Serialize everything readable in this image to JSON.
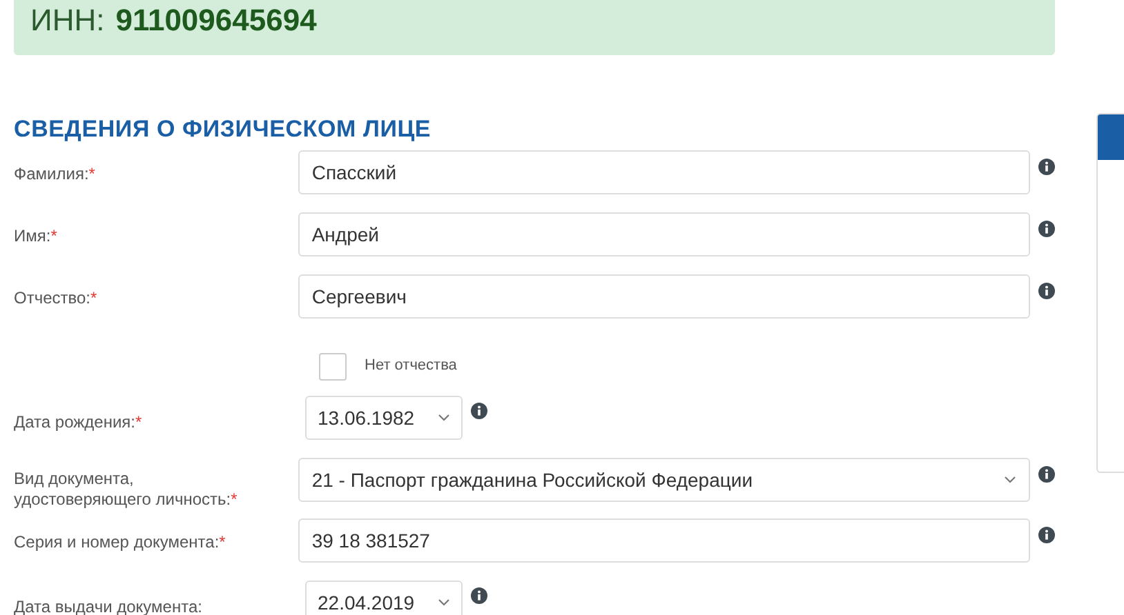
{
  "inn_banner": {
    "label": "ИНН:",
    "value": "911009645694"
  },
  "section_title": "СВЕДЕНИЯ О ФИЗИЧЕСКОМ ЛИЦЕ",
  "fields": [
    {
      "kind": "text",
      "label": "Фамилия:",
      "required_mark": "*",
      "value": "Спасский"
    },
    {
      "kind": "text",
      "label": "Имя:",
      "required_mark": "*",
      "value": "Андрей"
    },
    {
      "kind": "text",
      "label": "Отчество:",
      "required_mark": "*",
      "value": "Сергеевич"
    },
    {
      "kind": "checkbox",
      "label": "Нет отчества",
      "checked": false
    },
    {
      "kind": "date",
      "label": "Дата рождения:",
      "required_mark": "*",
      "value": "13.06.1982"
    },
    {
      "kind": "select",
      "label": "Вид документа, удостоверяющего личность:",
      "required_mark": "*",
      "value": "21 - Паспорт гражданина Российской Федерации"
    },
    {
      "kind": "text",
      "label": "Серия и номер документа:",
      "required_mark": "*",
      "value": "39 18 381527"
    },
    {
      "kind": "date",
      "label": "Дата выдачи документа:",
      "value": "22.04.2019"
    }
  ]
}
